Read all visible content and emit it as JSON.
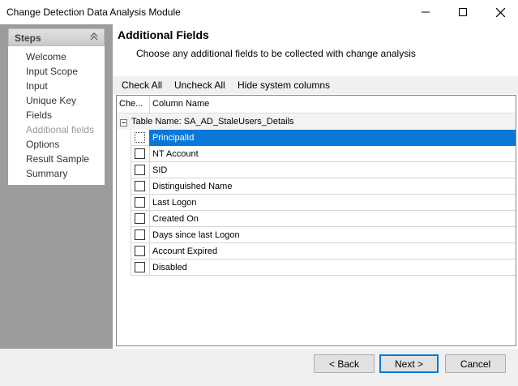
{
  "window": {
    "title": "Change Detection Data Analysis Module"
  },
  "steps": {
    "header": "Steps",
    "items": [
      {
        "label": "Welcome",
        "state": "normal"
      },
      {
        "label": "Input Scope",
        "state": "normal"
      },
      {
        "label": "Input",
        "state": "normal"
      },
      {
        "label": "Unique Key",
        "state": "normal"
      },
      {
        "label": "Fields",
        "state": "normal"
      },
      {
        "label": "Additional fields",
        "state": "current"
      },
      {
        "label": "Options",
        "state": "normal"
      },
      {
        "label": "Result Sample",
        "state": "normal"
      },
      {
        "label": "Summary",
        "state": "normal"
      }
    ]
  },
  "page": {
    "title": "Additional Fields",
    "description": "Choose any additional fields to be collected with change analysis"
  },
  "toolbar": {
    "check_all": "Check All",
    "uncheck_all": "Uncheck All",
    "hide_system": "Hide system columns"
  },
  "grid": {
    "columns": [
      "Che...",
      "Column Name"
    ],
    "group_label": "Table Name: SA_AD_StaleUsers_Details",
    "rows": [
      {
        "name": "PrincipalId",
        "checked": false,
        "selected": true
      },
      {
        "name": "NT Account",
        "checked": false,
        "selected": false
      },
      {
        "name": "SID",
        "checked": false,
        "selected": false
      },
      {
        "name": "Distinguished Name",
        "checked": false,
        "selected": false
      },
      {
        "name": "Last Logon",
        "checked": false,
        "selected": false
      },
      {
        "name": "Created On",
        "checked": false,
        "selected": false
      },
      {
        "name": "Days since last Logon",
        "checked": false,
        "selected": false
      },
      {
        "name": "Account Expired",
        "checked": false,
        "selected": false
      },
      {
        "name": "Disabled",
        "checked": false,
        "selected": false
      }
    ]
  },
  "footer": {
    "back": "< Back",
    "next": "Next >",
    "cancel": "Cancel"
  },
  "colors": {
    "selection": "#0a78d7",
    "panel": "#9c9c9c",
    "accent_border": "#0078d7"
  }
}
